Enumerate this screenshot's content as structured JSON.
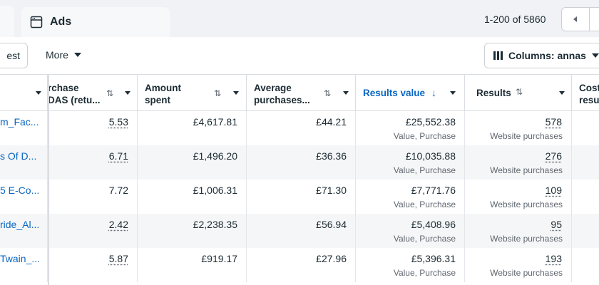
{
  "tabs": {
    "ads_label": "Ads"
  },
  "pagination": {
    "text": "1-200 of 5860"
  },
  "toolbar": {
    "test_label": "est",
    "more_label": "More",
    "columns_label": "Columns: annas"
  },
  "columns": {
    "purchase_roas_line1": "rchase",
    "purchase_roas_line2": "DAS (retu...",
    "amount_spent_line1": "Amount",
    "amount_spent_line2": "spent",
    "avg_purchases_line1": "Average",
    "avg_purchases_line2": "purchases...",
    "results_value": "Results value",
    "results": "Results",
    "cost_line1": "Cost",
    "cost_line2": "resu",
    "sort_icon": "⇅",
    "sort_desc_icon": "↓"
  },
  "rows": [
    {
      "name": "m_Fac...",
      "roas": "5.53",
      "amount": "£4,617.81",
      "avg": "£44.21",
      "value": "£25,552.38",
      "value_sub": "Value, Purchase",
      "results": "578",
      "results_sub": "Website purchases"
    },
    {
      "name": "s Of D...",
      "roas": "6.71",
      "amount": "£1,496.20",
      "avg": "£36.36",
      "value": "£10,035.88",
      "value_sub": "Value, Purchase",
      "results": "276",
      "results_sub": "Website purchases"
    },
    {
      "name": "5 E-Co...",
      "roas": "7.72",
      "amount": "£1,006.31",
      "avg": "£71.30",
      "value": "£7,771.76",
      "value_sub": "Value, Purchase",
      "results": "109",
      "results_sub": "Website purchases"
    },
    {
      "name": "ride_Al...",
      "roas": "2.42",
      "amount": "£2,238.35",
      "avg": "£56.94",
      "value": "£5,408.96",
      "value_sub": "Value, Purchase",
      "results": "95",
      "results_sub": "Website purchases"
    },
    {
      "name": "Twain_...",
      "roas": "5.87",
      "amount": "£919.17",
      "avg": "£27.96",
      "value": "£5,396.31",
      "value_sub": "Value, Purchase",
      "results": "193",
      "results_sub": "Website purchases"
    }
  ]
}
